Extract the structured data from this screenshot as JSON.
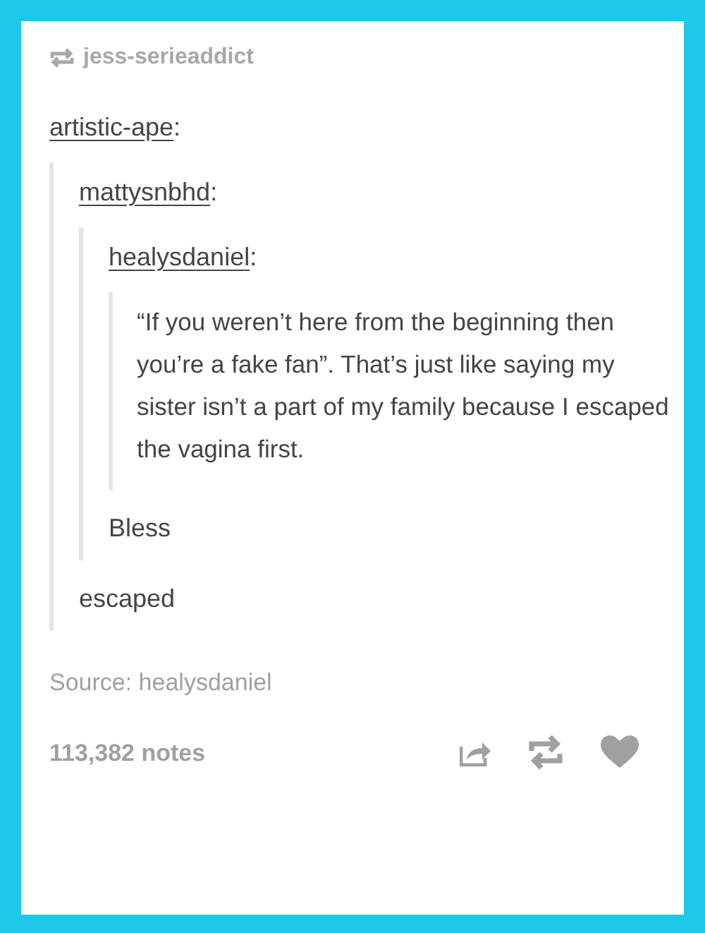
{
  "reblogged_by": "jess-serieaddict",
  "thread": {
    "user": "artistic-ape",
    "sep": ":",
    "quote": {
      "user": "mattysnbhd",
      "sep": ":",
      "quote": {
        "user": "healysdaniel",
        "sep": ":",
        "quote": {
          "text": "“If you weren’t here from the beginning then you’re a fake fan”. That’s just like saying my sister isn’t a part of my family because I escaped the vagina first."
        },
        "text": "Bless"
      },
      "text": "escaped"
    }
  },
  "source": "Source: healysdaniel",
  "notes": "113,382 notes"
}
